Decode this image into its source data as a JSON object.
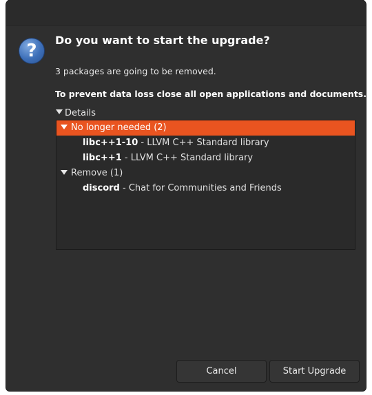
{
  "dialog": {
    "heading": "Do you want to start the upgrade?",
    "subtext": "3 packages are going to be removed.",
    "warning": "To prevent data loss close all open applications and documents.",
    "details_label": "Details",
    "icon": "question-icon",
    "icon_glyph": "?"
  },
  "tree": {
    "groups": [
      {
        "label": "No longer needed (2)",
        "expanded": true,
        "selected": true,
        "items": [
          {
            "name": "libc++1-10",
            "description": " - LLVM C++ Standard library"
          },
          {
            "name": "libc++1",
            "description": " - LLVM C++ Standard library"
          }
        ]
      },
      {
        "label": "Remove (1)",
        "expanded": true,
        "selected": false,
        "items": [
          {
            "name": "discord",
            "description": " - Chat for Communities and Friends"
          }
        ]
      }
    ]
  },
  "buttons": {
    "cancel": "Cancel",
    "start": "Start Upgrade"
  },
  "colors": {
    "accent": "#e95420",
    "background": "#2f2f2f"
  }
}
